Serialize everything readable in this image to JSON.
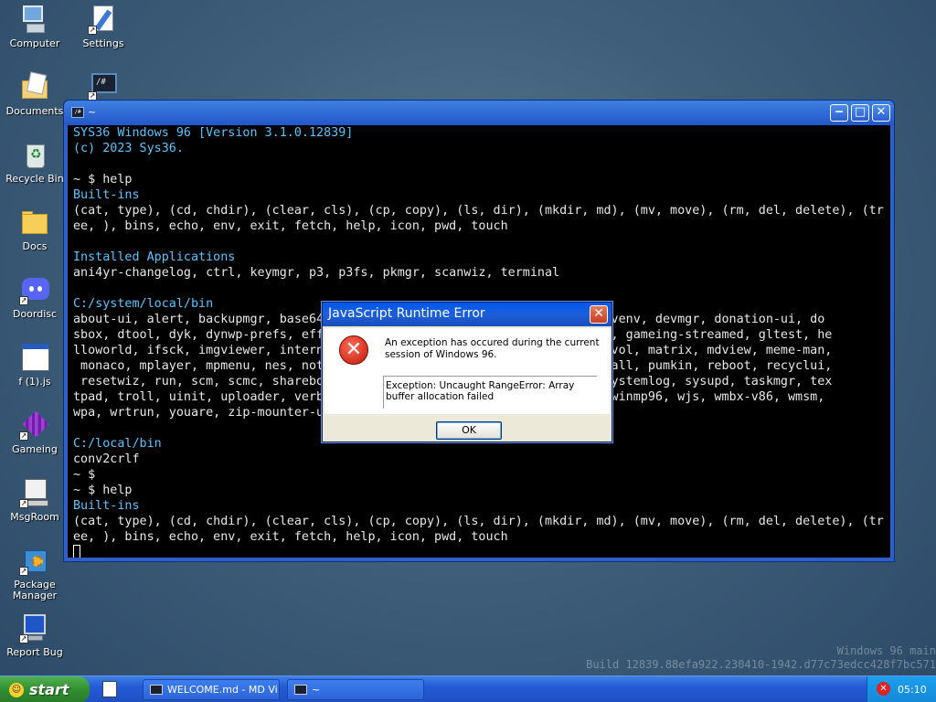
{
  "desktop": {
    "icons": [
      {
        "label": "Computer"
      },
      {
        "label": "Settings"
      },
      {
        "label": "Documents"
      },
      {
        "label": "Recycle Bin"
      },
      {
        "label": "Docs"
      },
      {
        "label": "Doordisc"
      },
      {
        "label": "f (1).js"
      },
      {
        "label": "Gameing"
      },
      {
        "label": "MsgRoom"
      },
      {
        "label": "Package Manager"
      },
      {
        "label": "Report Bug"
      }
    ]
  },
  "terminal": {
    "title": "~",
    "lines": [
      {
        "text": "SYS36 Windows 96 [Version 3.1.0.12839]",
        "color": "cyan"
      },
      {
        "text": "(c) 2023 Sys36.",
        "color": "cyan"
      },
      {
        "text": "",
        "color": "white"
      },
      {
        "text": "~ $ help",
        "color": "white"
      },
      {
        "text": "Built-ins",
        "color": "cyan"
      },
      {
        "text": "(cat, type), (cd, chdir), (clear, cls), (cp, copy), (ls, dir), (mkdir, md), (mv, move), (rm, del, delete), (tr",
        "color": "white"
      },
      {
        "text": "ee, ), bins, echo, env, exit, fetch, help, icon, pwd, touch",
        "color": "white"
      },
      {
        "text": "",
        "color": "white"
      },
      {
        "text": "Installed Applications",
        "color": "cyan"
      },
      {
        "text": "ani4yr-changelog, ctrl, keymgr, p3, p3fs, pkmgr, scanwiz, terminal",
        "color": "white"
      },
      {
        "text": "",
        "color": "white"
      },
      {
        "text": "C:/system/local/bin",
        "color": "cyan"
      },
      {
        "text": "about-ui, alert, backupmgr, base64                                its, devenv, devmgr, donation-ui, do",
        "color": "white"
      },
      {
        "text": "sbox, dtool, dyk, dynwp-prefs, effe                                runner, gameing-streamed, gltest, he",
        "color": "white"
      },
      {
        "text": "lloworld, ifsck, imgviewer, interne                                on, lsvol, matrix, mdview, meme-man,",
        "color": "white"
      },
      {
        "text": " monaco, mplayer, mpmenu, nes, notr                                , pinball, pumkin, reboot, recyclui,",
        "color": "white"
      },
      {
        "text": " resetwiz, run, scm, scmc, shareboa                                erm, systemlog, sysupd, taskmgr, tex",
        "color": "white"
      },
      {
        "text": "tpad, troll, uinit, uploader, verbi                                chat, winmp96, wjs, wmbx-v86, wmsm,",
        "color": "white"
      },
      {
        "text": "wpa, wrtrun, youare, zip-mounter-ui",
        "color": "white"
      },
      {
        "text": "",
        "color": "white"
      },
      {
        "text": "C:/local/bin",
        "color": "cyan"
      },
      {
        "text": "conv2crlf",
        "color": "white"
      },
      {
        "text": "~ $",
        "color": "white"
      },
      {
        "text": "~ $ help",
        "color": "white"
      },
      {
        "text": "Built-ins",
        "color": "cyan"
      },
      {
        "text": "(cat, type), (cd, chdir), (clear, cls), (cp, copy), (ls, dir), (mkdir, md), (mv, move), (rm, del, delete), (tr",
        "color": "white"
      },
      {
        "text": "ee, ), bins, echo, env, exit, fetch, help, icon, pwd, touch",
        "color": "white"
      }
    ],
    "buttons": {
      "minimize": "‒",
      "maximize": "□",
      "close": "✕"
    }
  },
  "dialog": {
    "title": "JavaScript Runtime Error",
    "message": "An exception has occured during the current session of Windows 96.",
    "exception": "Exception: Uncaught RangeError: Array buffer allocation failed",
    "ok_label": "OK",
    "close_glyph": "✕"
  },
  "watermark": {
    "line1": "Windows 96 main",
    "line2": "Build 12839.88efa922.230410-1942.d77c73edcc428f7bc571"
  },
  "taskbar": {
    "start_label": "start",
    "tasks": [
      {
        "label": "WELCOME.md - MD Vi..."
      },
      {
        "label": "~"
      }
    ],
    "clock": "05:10"
  },
  "colors": {
    "terminal_cyan": "#59c5ff",
    "terminal_bg": "#000000",
    "title_blue": "#2456c8",
    "start_green": "#2f8c2f"
  }
}
